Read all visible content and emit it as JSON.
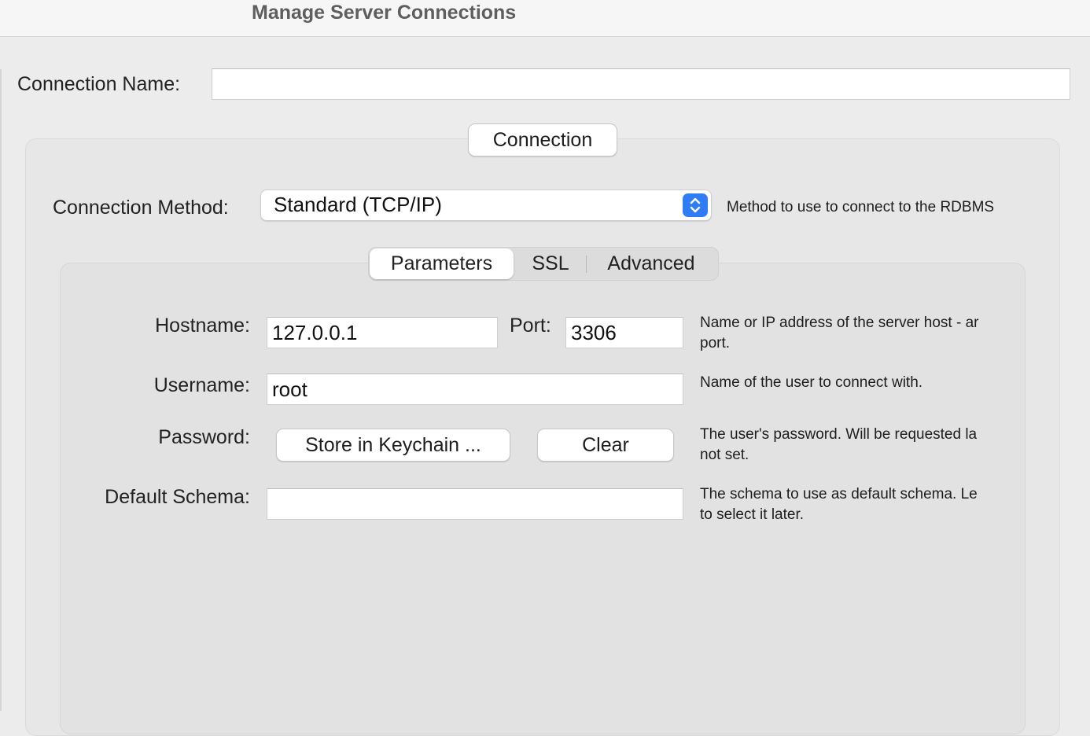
{
  "window": {
    "title": "Manage Server Connections"
  },
  "connection_name": {
    "label": "Connection Name:",
    "value": ""
  },
  "connection_group": {
    "tab_label": "Connection"
  },
  "connection_method": {
    "label": "Connection Method:",
    "selected": "Standard (TCP/IP)",
    "help": "Method to use to connect to the RDBMS"
  },
  "tabs": {
    "items": [
      {
        "label": "Parameters",
        "active": true
      },
      {
        "label": "SSL",
        "active": false
      },
      {
        "label": "Advanced",
        "active": false
      }
    ]
  },
  "parameters": {
    "hostname": {
      "label": "Hostname:",
      "value": "127.0.0.1"
    },
    "port": {
      "label": "Port:",
      "value": "3306"
    },
    "hostname_help": {
      "line1": "Name or IP address of the server host - ar",
      "line2": "port."
    },
    "username": {
      "label": "Username:",
      "value": "root",
      "help": "Name of the user to connect with."
    },
    "password": {
      "label": "Password:",
      "store_button": "Store in Keychain ...",
      "clear_button": "Clear",
      "help_line1": "The user's password. Will be requested la",
      "help_line2": "not set."
    },
    "default_schema": {
      "label": "Default Schema:",
      "value": "",
      "help_line1": "The schema to use as default schema. Le",
      "help_line2": "to select it later."
    }
  },
  "colors": {
    "accent": "#2f7cf6",
    "window_bg": "#ececec",
    "group_bg": "#e7e7e7"
  }
}
